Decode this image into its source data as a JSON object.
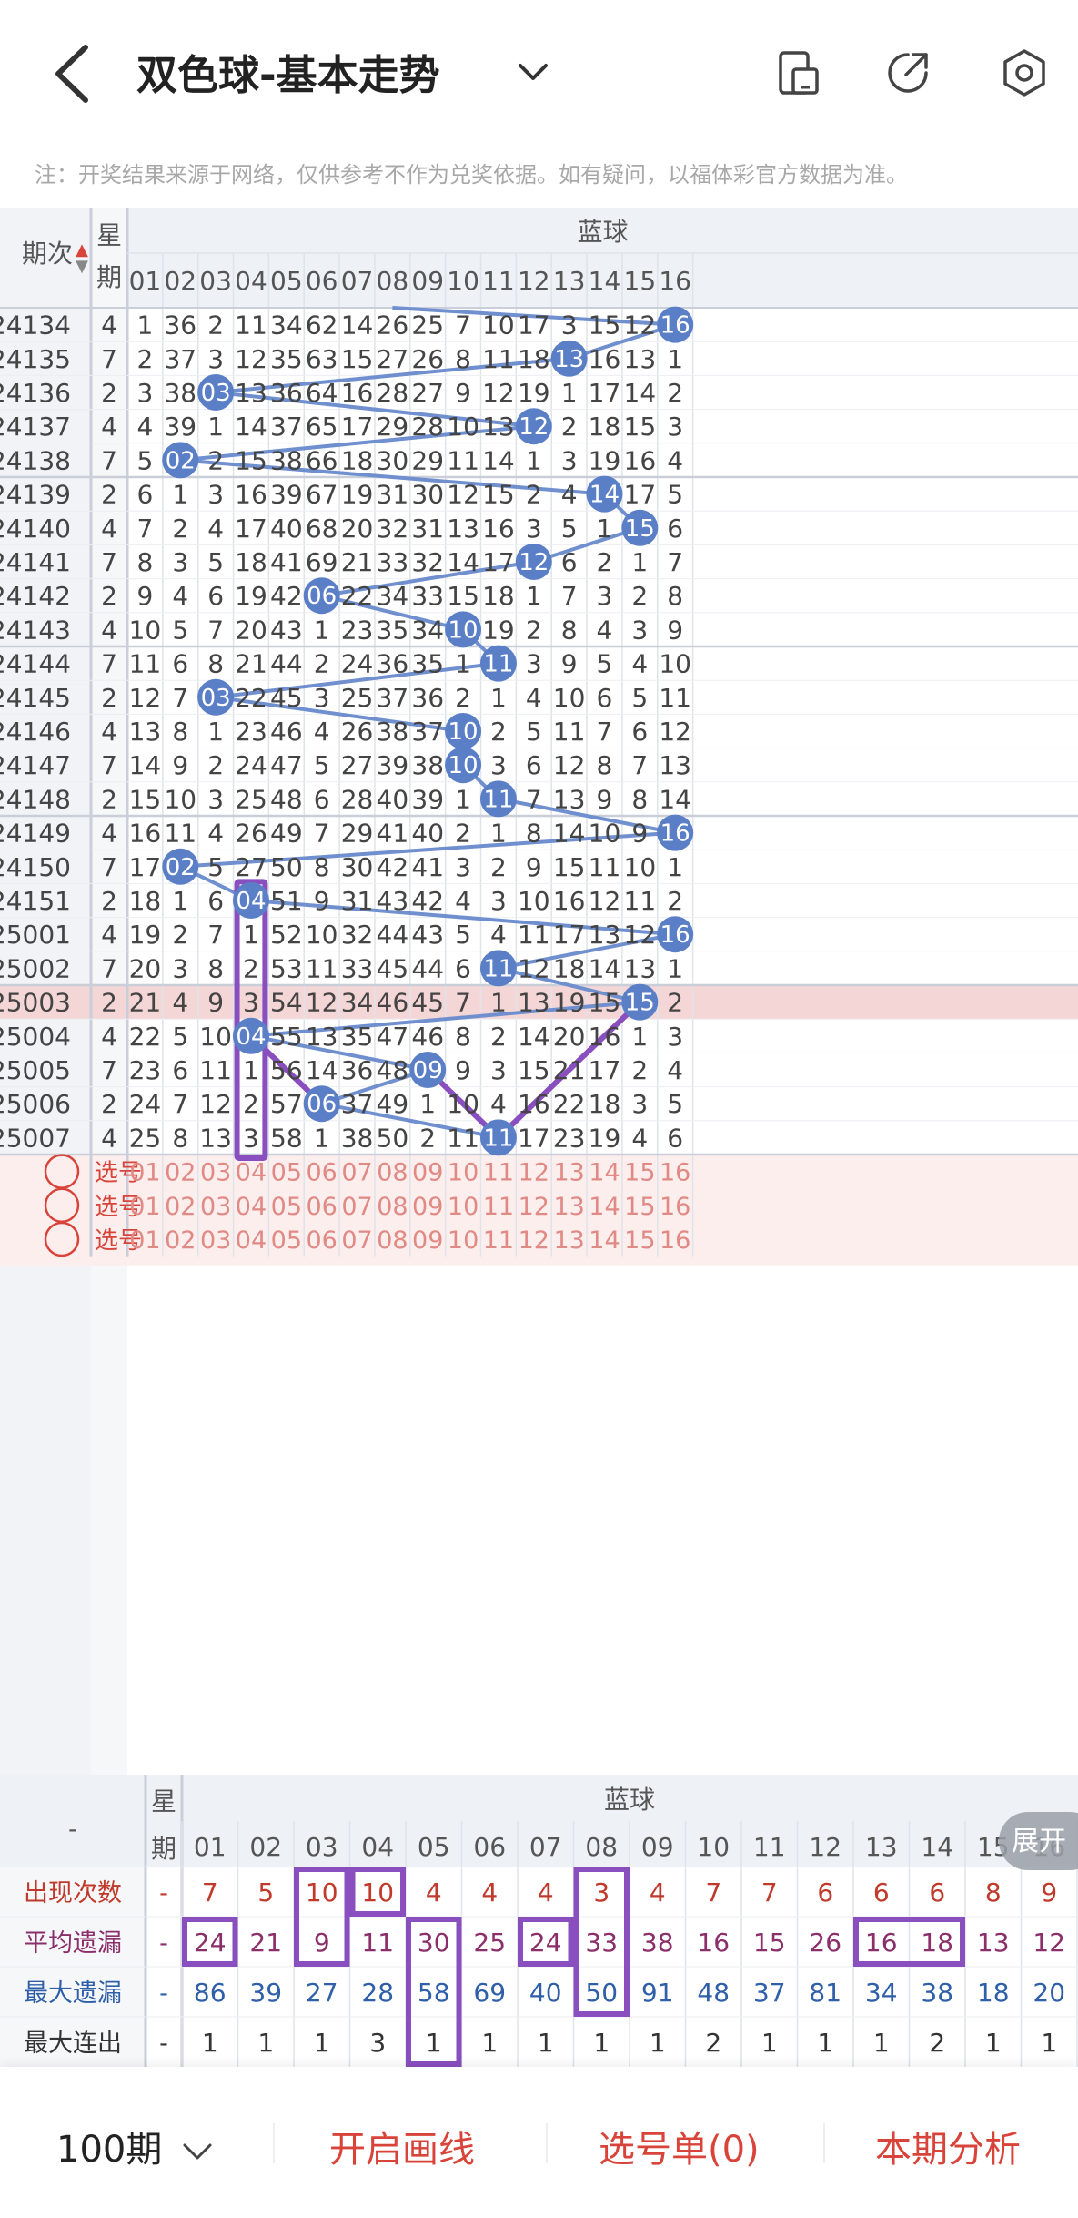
{
  "header": {
    "title": "双色球-基本走势",
    "note": "注：开奖结果来源于网络，仅供参考不作为兑奖依据。如有疑问，以福体彩官方数据为准。",
    "icons": [
      "back-icon",
      "chevron-down-icon",
      "device-icon",
      "share-icon",
      "settings-icon"
    ]
  },
  "table": {
    "issue_header": "期次",
    "week_header": "星期",
    "blue_header": "蓝球",
    "columns": [
      "01",
      "02",
      "03",
      "04",
      "05",
      "06",
      "07",
      "08",
      "09",
      "10",
      "11",
      "12",
      "13",
      "14",
      "15",
      "16"
    ],
    "rows": [
      {
        "issue": "24134",
        "week": "4",
        "cells": [
          "1",
          "36",
          "2",
          "11",
          "34",
          "62",
          "14",
          "26",
          "25",
          "7",
          "10",
          "17",
          "3",
          "15",
          "12",
          "16"
        ],
        "hit": 16
      },
      {
        "issue": "24135",
        "week": "7",
        "cells": [
          "2",
          "37",
          "3",
          "12",
          "35",
          "63",
          "15",
          "27",
          "26",
          "8",
          "11",
          "18",
          "13",
          "16",
          "13",
          "1"
        ],
        "hit": 13
      },
      {
        "issue": "24136",
        "week": "2",
        "cells": [
          "3",
          "38",
          "03",
          "13",
          "36",
          "64",
          "16",
          "28",
          "27",
          "9",
          "12",
          "19",
          "1",
          "17",
          "14",
          "2"
        ],
        "hit": 3
      },
      {
        "issue": "24137",
        "week": "4",
        "cells": [
          "4",
          "39",
          "1",
          "14",
          "37",
          "65",
          "17",
          "29",
          "28",
          "10",
          "13",
          "12",
          "2",
          "18",
          "15",
          "3"
        ],
        "hit": 12
      },
      {
        "issue": "24138",
        "week": "7",
        "cells": [
          "5",
          "02",
          "2",
          "15",
          "38",
          "66",
          "18",
          "30",
          "29",
          "11",
          "14",
          "1",
          "3",
          "19",
          "16",
          "4"
        ],
        "hit": 2
      },
      {
        "issue": "24139",
        "week": "2",
        "cells": [
          "6",
          "1",
          "3",
          "16",
          "39",
          "67",
          "19",
          "31",
          "30",
          "12",
          "15",
          "2",
          "4",
          "14",
          "17",
          "5"
        ],
        "hit": 14
      },
      {
        "issue": "24140",
        "week": "4",
        "cells": [
          "7",
          "2",
          "4",
          "17",
          "40",
          "68",
          "20",
          "32",
          "31",
          "13",
          "16",
          "3",
          "5",
          "1",
          "15",
          "6"
        ],
        "hit": 15
      },
      {
        "issue": "24141",
        "week": "7",
        "cells": [
          "8",
          "3",
          "5",
          "18",
          "41",
          "69",
          "21",
          "33",
          "32",
          "14",
          "17",
          "12",
          "6",
          "2",
          "1",
          "7"
        ],
        "hit": 12
      },
      {
        "issue": "24142",
        "week": "2",
        "cells": [
          "9",
          "4",
          "6",
          "19",
          "42",
          "06",
          "22",
          "34",
          "33",
          "15",
          "18",
          "1",
          "7",
          "3",
          "2",
          "8"
        ],
        "hit": 6
      },
      {
        "issue": "24143",
        "week": "4",
        "cells": [
          "10",
          "5",
          "7",
          "20",
          "43",
          "1",
          "23",
          "35",
          "34",
          "10",
          "19",
          "2",
          "8",
          "4",
          "3",
          "9"
        ],
        "hit": 10
      },
      {
        "issue": "24144",
        "week": "7",
        "cells": [
          "11",
          "6",
          "8",
          "21",
          "44",
          "2",
          "24",
          "36",
          "35",
          "1",
          "11",
          "3",
          "9",
          "5",
          "4",
          "10"
        ],
        "hit": 11
      },
      {
        "issue": "24145",
        "week": "2",
        "cells": [
          "12",
          "7",
          "03",
          "22",
          "45",
          "3",
          "25",
          "37",
          "36",
          "2",
          "1",
          "4",
          "10",
          "6",
          "5",
          "11"
        ],
        "hit": 3
      },
      {
        "issue": "24146",
        "week": "4",
        "cells": [
          "13",
          "8",
          "1",
          "23",
          "46",
          "4",
          "26",
          "38",
          "37",
          "10",
          "2",
          "5",
          "11",
          "7",
          "6",
          "12"
        ],
        "hit": 10
      },
      {
        "issue": "24147",
        "week": "7",
        "cells": [
          "14",
          "9",
          "2",
          "24",
          "47",
          "5",
          "27",
          "39",
          "38",
          "10",
          "3",
          "6",
          "12",
          "8",
          "7",
          "13"
        ],
        "hit": 10
      },
      {
        "issue": "24148",
        "week": "2",
        "cells": [
          "15",
          "10",
          "3",
          "25",
          "48",
          "6",
          "28",
          "40",
          "39",
          "1",
          "11",
          "7",
          "13",
          "9",
          "8",
          "14"
        ],
        "hit": 11
      },
      {
        "issue": "24149",
        "week": "4",
        "cells": [
          "16",
          "11",
          "4",
          "26",
          "49",
          "7",
          "29",
          "41",
          "40",
          "2",
          "1",
          "8",
          "14",
          "10",
          "9",
          "16"
        ],
        "hit": 16
      },
      {
        "issue": "24150",
        "week": "7",
        "cells": [
          "17",
          "02",
          "5",
          "27",
          "50",
          "8",
          "30",
          "42",
          "41",
          "3",
          "2",
          "9",
          "15",
          "11",
          "10",
          "1"
        ],
        "hit": 2
      },
      {
        "issue": "24151",
        "week": "2",
        "cells": [
          "18",
          "1",
          "6",
          "04",
          "51",
          "9",
          "31",
          "43",
          "42",
          "4",
          "3",
          "10",
          "16",
          "12",
          "11",
          "2"
        ],
        "hit": 4
      },
      {
        "issue": "25001",
        "week": "4",
        "cells": [
          "19",
          "2",
          "7",
          "1",
          "52",
          "10",
          "32",
          "44",
          "43",
          "5",
          "4",
          "11",
          "17",
          "13",
          "12",
          "16"
        ],
        "hit": 16
      },
      {
        "issue": "25002",
        "week": "7",
        "cells": [
          "20",
          "3",
          "8",
          "2",
          "53",
          "11",
          "33",
          "45",
          "44",
          "6",
          "11",
          "12",
          "18",
          "14",
          "13",
          "1"
        ],
        "hit": 11
      },
      {
        "issue": "25003",
        "week": "2",
        "cells": [
          "21",
          "4",
          "9",
          "3",
          "54",
          "12",
          "34",
          "46",
          "45",
          "7",
          "1",
          "13",
          "19",
          "15",
          "15",
          "2"
        ],
        "hit": 15
      },
      {
        "issue": "25004",
        "week": "4",
        "cells": [
          "22",
          "5",
          "10",
          "04",
          "55",
          "13",
          "35",
          "47",
          "46",
          "8",
          "2",
          "14",
          "20",
          "16",
          "1",
          "3"
        ],
        "hit": 4
      },
      {
        "issue": "25005",
        "week": "7",
        "cells": [
          "23",
          "6",
          "11",
          "1",
          "56",
          "14",
          "36",
          "48",
          "09",
          "9",
          "3",
          "15",
          "21",
          "17",
          "2",
          "4"
        ],
        "hit": 9
      },
      {
        "issue": "25006",
        "week": "2",
        "cells": [
          "24",
          "7",
          "12",
          "2",
          "57",
          "06",
          "37",
          "49",
          "1",
          "10",
          "4",
          "16",
          "22",
          "18",
          "3",
          "5"
        ],
        "hit": 6
      },
      {
        "issue": "25007",
        "week": "4",
        "cells": [
          "25",
          "8",
          "13",
          "3",
          "58",
          "1",
          "38",
          "50",
          "2",
          "11",
          "11",
          "17",
          "23",
          "19",
          "4",
          "6"
        ],
        "hit": 11
      }
    ],
    "select_label": "选号",
    "select_rows": 3
  },
  "stats": {
    "dash": "-",
    "week_header": "星期",
    "blue_header": "蓝球",
    "expand_label": "展开",
    "rows": [
      {
        "label": "出现次数",
        "dash": "-",
        "values": [
          "7",
          "5",
          "10",
          "10",
          "4",
          "4",
          "4",
          "3",
          "4",
          "7",
          "7",
          "6",
          "6",
          "6",
          "8",
          "9"
        ],
        "color": "#c0392b"
      },
      {
        "label": "平均遗漏",
        "dash": "-",
        "values": [
          "24",
          "21",
          "9",
          "11",
          "30",
          "25",
          "24",
          "33",
          "38",
          "16",
          "15",
          "26",
          "16",
          "18",
          "13",
          "12"
        ],
        "color": "#8b2f6b"
      },
      {
        "label": "最大遗漏",
        "dash": "-",
        "values": [
          "86",
          "39",
          "27",
          "28",
          "58",
          "69",
          "40",
          "50",
          "91",
          "48",
          "37",
          "81",
          "34",
          "38",
          "18",
          "20"
        ],
        "color": "#2f5fa8"
      },
      {
        "label": "最大连出",
        "dash": "-",
        "values": [
          "1",
          "1",
          "1",
          "3",
          "1",
          "1",
          "1",
          "1",
          "1",
          "2",
          "1",
          "1",
          "1",
          "2",
          "1",
          "1"
        ],
        "color": "#333"
      }
    ]
  },
  "bottom": {
    "period": "100期",
    "draw_line": "开启画线",
    "selection": "选号单(0)",
    "analysis": "本期分析"
  },
  "colors": {
    "blue_ball": "#5b7fc7",
    "line": "#6f8fcf",
    "purple": "#8a4fbf",
    "accent_red": "#d9443a",
    "highlight_row": "#f5d6d6",
    "select_bg": "#fdeeee"
  }
}
